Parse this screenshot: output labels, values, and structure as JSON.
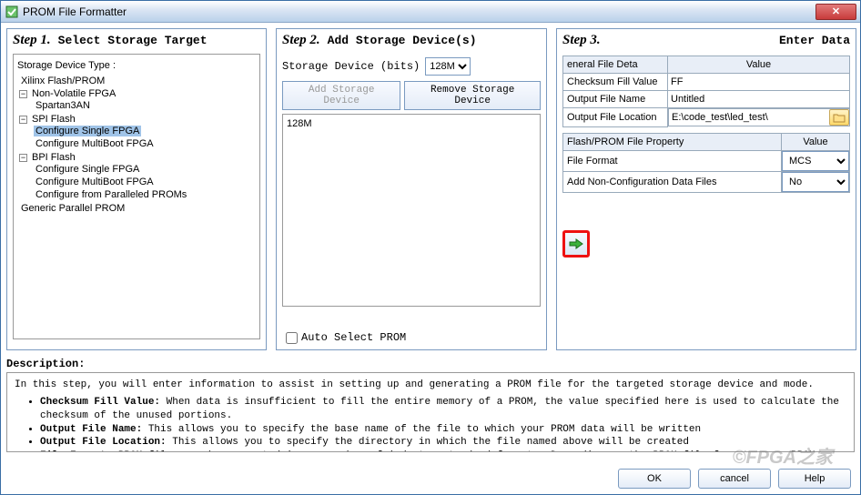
{
  "window": {
    "title": "PROM File Formatter"
  },
  "steps": {
    "s1": {
      "num": "Step 1.",
      "title": "Select Storage Target"
    },
    "s2": {
      "num": "Step 2.",
      "title": "Add Storage Device(s)"
    },
    "s3": {
      "num": "Step 3.",
      "title": "Enter Data"
    }
  },
  "tree": {
    "header": "Storage Device Type :",
    "items": {
      "n0": "Xilinx Flash/PROM",
      "n1": "Non-Volatile FPGA",
      "n1a": "Spartan3AN",
      "n2": "SPI Flash",
      "n2a": "Configure Single FPGA",
      "n2b": "Configure MultiBoot FPGA",
      "n3": "BPI Flash",
      "n3a": "Configure Single FPGA",
      "n3b": "Configure MultiBoot FPGA",
      "n3c": "Configure from Paralleled PROMs",
      "n4": "Generic Parallel PROM"
    }
  },
  "step2": {
    "label": "Storage Device (bits)",
    "size": "128M",
    "add": "Add Storage Device",
    "remove": "Remove Storage Device",
    "list0": "128M",
    "auto": "Auto Select PROM"
  },
  "step3": {
    "headA": "eneral File Deta",
    "headB": "Value",
    "rows": {
      "r1k": "Checksum Fill Value",
      "r1v": "FF",
      "r2k": "Output File Name",
      "r2v": "Untitled",
      "r3k": "Output File Location",
      "r3v": "E:\\code_test\\led_test\\"
    },
    "headC": "Flash/PROM File Property",
    "headD": "Value",
    "rows2": {
      "r4k": "File Format",
      "r4v": "MCS",
      "r5k": "Add Non-Configuration Data Files",
      "r5v": "No"
    }
  },
  "desc": {
    "label": "Description:",
    "intro": "In this step, you will enter information to assist in setting up and generating a PROM file for the targeted storage device and mode.",
    "b1t": "Checksum Fill Value:",
    "b1": " When data is insufficient to fill the entire memory of a PROM, the value specified here is used to calculate the checksum of the unused portions.",
    "b2t": "Output File Name:",
    "b2": " This allows you to specify the base name of the file to which your PROM data will be written",
    "b3t": "Output File Location:",
    "b3": " This allows you to specify the directory in which the file named above will be created",
    "b4t": "File Format:",
    "b4": " PROM files can be generated in any number of industry standard formats. Depending on the PROM file format, your PROM programmer"
  },
  "footer": {
    "ok": "OK",
    "cancel": "cancel",
    "help": "Help"
  },
  "watermark": "©FPGA之家"
}
